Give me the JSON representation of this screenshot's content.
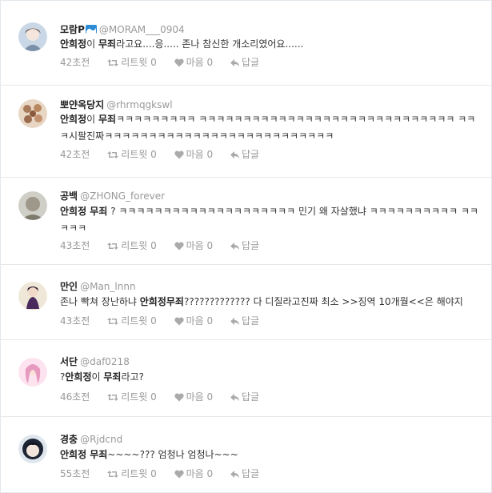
{
  "tweets": [
    {
      "name": "모람P",
      "handle": "@MORAM___0904",
      "verified_icon": "wave-icon",
      "text_parts": [
        {
          "t": "안희정",
          "b": true
        },
        {
          "t": "이 ",
          "b": false
        },
        {
          "t": "무죄",
          "b": true
        },
        {
          "t": "라고요....응..... 존나 참신한 개소리였어요......",
          "b": false
        }
      ],
      "time": "42초전",
      "retweet": "리트윗 0",
      "like": "마음 0",
      "reply": "답글",
      "avatar_colors": [
        "#c9d7e6",
        "#7a8fa8"
      ]
    },
    {
      "name": "뽀얀옥당지",
      "handle": "@rhrmqgkswl",
      "text_parts": [
        {
          "t": "안희정",
          "b": true
        },
        {
          "t": "이 ",
          "b": false
        },
        {
          "t": "무죄",
          "b": true
        },
        {
          "t": "ㅋㅋㅋㅋㅋㅋㅋㅋㅋ ㅋㅋㅋㅋㅋㅋㅋㅋㅋㅋㅋㅋㅋㅋㅋㅋㅋㅋㅋㅋㅋㅋㅋㅋㅋㅋㅋㅋㅋ ㅋㅋㅋ시팔진짜ㅋㅋㅋㅋㅋㅋㅋㅋㅋㅋㅋㅋㅋㅋㅋㅋㅋㅋㅋㅋㅋㅋㅋㅋㅋㅋ",
          "b": false
        }
      ],
      "time": "42초전",
      "retweet": "리트윗 0",
      "like": "마음 0",
      "reply": "답글",
      "avatar_colors": [
        "#e8d6c4",
        "#a77a5a"
      ]
    },
    {
      "name": "공백",
      "handle": "@ZHONG_forever",
      "text_parts": [
        {
          "t": "안희정 무죄",
          "b": true
        },
        {
          "t": " ? ㅋㅋㅋㅋㅋㅋㅋㅋㅋㅋㅋㅋㅋㅋㅋㅋㅋㅋㅋㅋ 민기 왜 자살했냐 ㅋㅋㅋㅋㅋㅋㅋㅋㅋㅋ ㅋㅋㅋㅋㅋ",
          "b": false
        }
      ],
      "time": "43초전",
      "retweet": "리트윗 0",
      "like": "마음 0",
      "reply": "답글",
      "avatar_colors": [
        "#cfcfc7",
        "#7f7a6e"
      ]
    },
    {
      "name": "만인",
      "handle": "@Man_lnnn",
      "text_parts": [
        {
          "t": "존나 빡쳐 장난하냐 ",
          "b": false
        },
        {
          "t": "안희정무죄",
          "b": true
        },
        {
          "t": "????????????? 다 디질라고진짜 최소 >>징역 10개월<<은 해야지",
          "b": false
        }
      ],
      "time": "43초전",
      "retweet": "리트윗 0",
      "like": "마음 0",
      "reply": "답글",
      "avatar_colors": [
        "#efe7d8",
        "#4a2a5c"
      ]
    },
    {
      "name": "서단",
      "handle": "@daf0218",
      "text_parts": [
        {
          "t": "?",
          "b": false
        },
        {
          "t": "안희정",
          "b": true
        },
        {
          "t": "이 ",
          "b": false
        },
        {
          "t": "무죄",
          "b": true
        },
        {
          "t": "라고?",
          "b": false
        }
      ],
      "time": "46초전",
      "retweet": "리트윗 0",
      "like": "마음 0",
      "reply": "답글",
      "avatar_colors": [
        "#fde3ef",
        "#e79ac0"
      ]
    },
    {
      "name": "경충",
      "handle": "@Rjdcnd",
      "text_parts": [
        {
          "t": "안희정 무죄",
          "b": true
        },
        {
          "t": "~~~~??? 엄청나 엄청나~~~",
          "b": false
        }
      ],
      "time": "55초전",
      "retweet": "리트윗 0",
      "like": "마음 0",
      "reply": "답글",
      "avatar_colors": [
        "#dfe6ee",
        "#1d2433"
      ]
    }
  ]
}
